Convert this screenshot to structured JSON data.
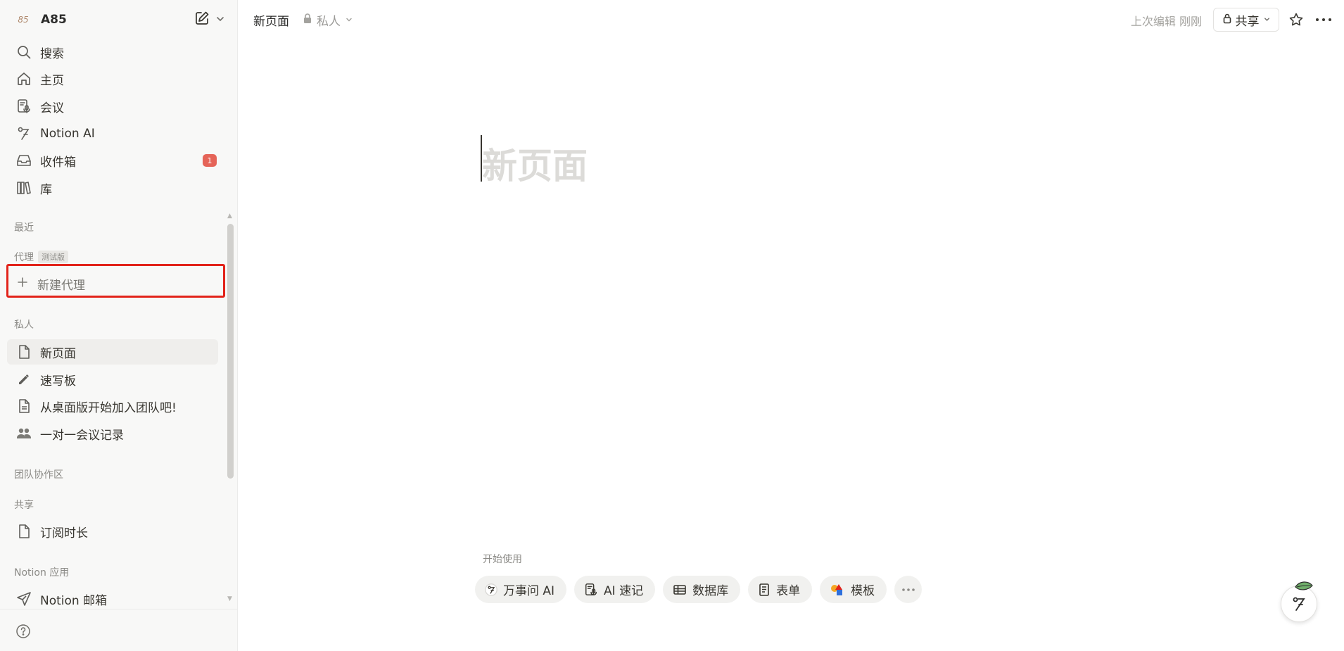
{
  "workspace": {
    "avatar": "85",
    "name": "A85"
  },
  "nav": {
    "search": "搜索",
    "home": "主页",
    "meetings": "会议",
    "notion_ai": "Notion AI",
    "inbox": "收件箱",
    "inbox_count": "1",
    "library": "库"
  },
  "sections": {
    "recent": "最近",
    "agents": "代理",
    "agents_badge": "测试版",
    "private": "私人",
    "teamspace": "团队协作区",
    "shared": "共享",
    "apps": "Notion 应用"
  },
  "new_agent": "新建代理",
  "private_pages": [
    "新页面",
    "速写板",
    "从桌面版开始加入团队吧!",
    "一对一会议记录"
  ],
  "shared_pages": [
    "订阅时长"
  ],
  "apps": [
    "Notion 邮箱"
  ],
  "topbar": {
    "breadcrumb": "新页面",
    "privacy": "私人",
    "last_edited": "上次编辑 刚刚",
    "share": "共享"
  },
  "page": {
    "title_placeholder": "新页面",
    "get_started": "开始使用",
    "chips": [
      "万事问 AI",
      "AI 速记",
      "数据库",
      "表单",
      "模板"
    ]
  },
  "colors": {
    "accent_red": "#e2231a",
    "badge": "#e56458",
    "sidebar_bg": "#f8f8f7"
  }
}
